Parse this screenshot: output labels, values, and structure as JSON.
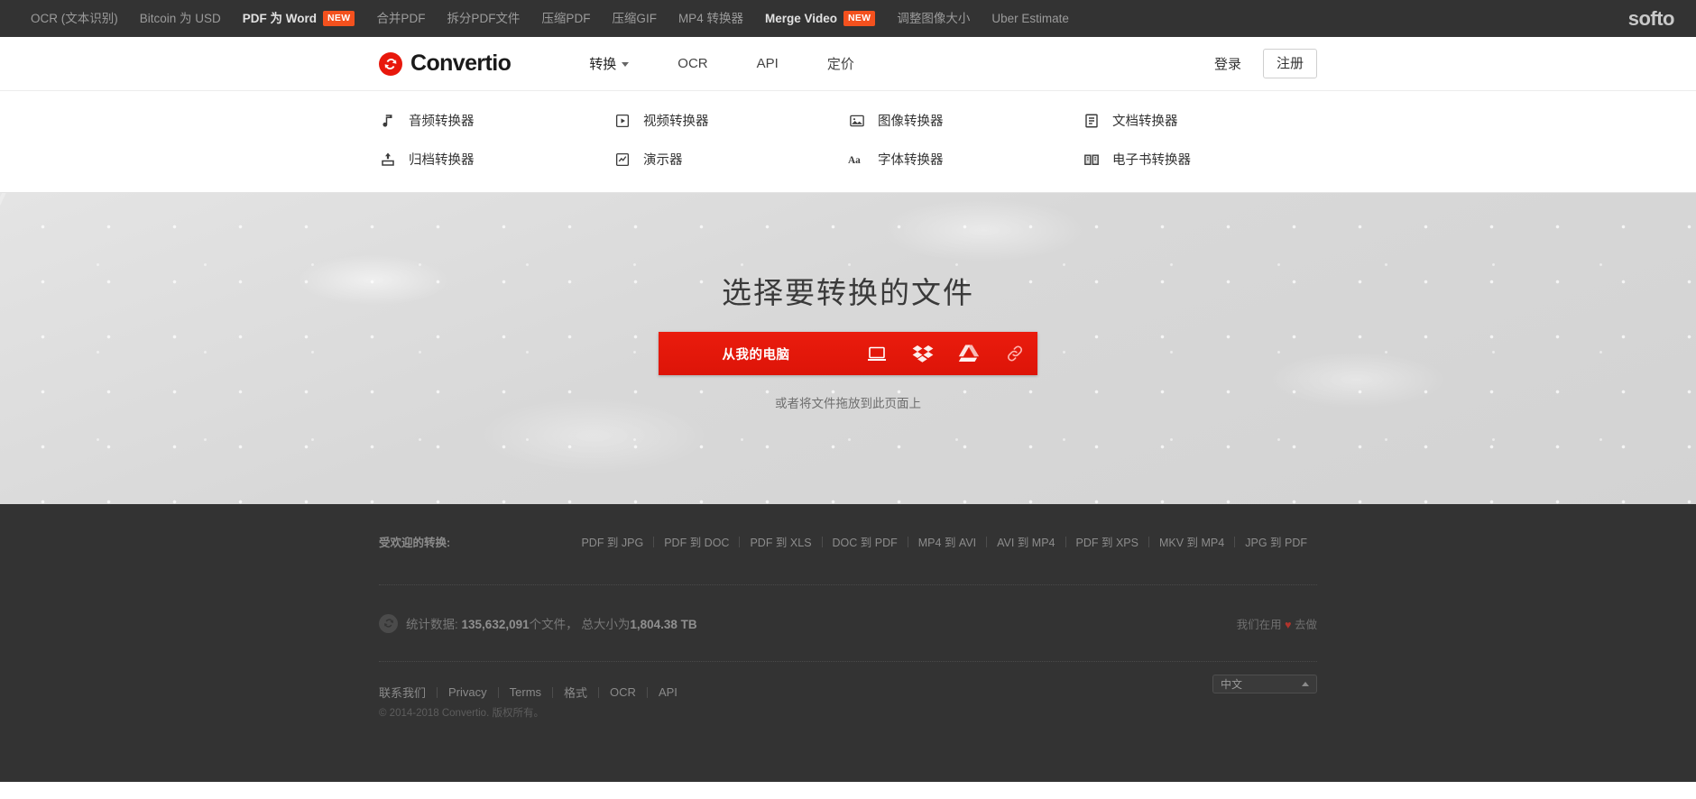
{
  "topbar": {
    "links": [
      {
        "label": "OCR (文本识别)",
        "bold": false,
        "badge": ""
      },
      {
        "label": "Bitcoin 为 USD",
        "bold": false,
        "badge": ""
      },
      {
        "label": "PDF 为 Word",
        "bold": true,
        "badge": "NEW"
      },
      {
        "label": "合并PDF",
        "bold": false,
        "badge": ""
      },
      {
        "label": "拆分PDF文件",
        "bold": false,
        "badge": ""
      },
      {
        "label": "压缩PDF",
        "bold": false,
        "badge": ""
      },
      {
        "label": "压缩GIF",
        "bold": false,
        "badge": ""
      },
      {
        "label": "MP4 转换器",
        "bold": false,
        "badge": ""
      },
      {
        "label": "Merge Video",
        "bold": true,
        "badge": "NEW"
      },
      {
        "label": "调整图像大小",
        "bold": false,
        "badge": ""
      },
      {
        "label": "Uber Estimate",
        "bold": false,
        "badge": ""
      }
    ],
    "brand": "softo",
    "badge_color": "#f4511e",
    "background": "#333333"
  },
  "header": {
    "logo_text": "Convertio",
    "logo_color": "#e8180c",
    "nav": [
      {
        "label": "转换",
        "has_caret": true
      },
      {
        "label": "OCR",
        "has_caret": false
      },
      {
        "label": "API",
        "has_caret": false
      },
      {
        "label": "定价",
        "has_caret": false
      }
    ],
    "login_label": "登录",
    "signup_label": "注册"
  },
  "megamenu": {
    "items": [
      {
        "label": "音频转换器",
        "icon": "music-note-icon"
      },
      {
        "label": "视频转换器",
        "icon": "video-play-icon"
      },
      {
        "label": "图像转换器",
        "icon": "image-icon"
      },
      {
        "label": "文档转换器",
        "icon": "document-icon"
      },
      {
        "label": "归档转换器",
        "icon": "archive-box-icon"
      },
      {
        "label": "演示器",
        "icon": "presentation-icon"
      },
      {
        "label": "字体转换器",
        "icon": "font-aa-icon"
      },
      {
        "label": "电子书转换器",
        "icon": "ebook-icon"
      }
    ]
  },
  "hero": {
    "title": "选择要转换的文件",
    "upload_label": "从我的电脑",
    "button_color": "#e8180c",
    "sources": [
      {
        "name": "my-computer",
        "icon": "laptop-icon"
      },
      {
        "name": "dropbox",
        "icon": "dropbox-icon"
      },
      {
        "name": "google-drive",
        "icon": "google-drive-icon"
      },
      {
        "name": "from-url",
        "icon": "link-icon"
      }
    ],
    "drop_hint": "或者将文件拖放到此页面上"
  },
  "footer": {
    "popular_label": "受欢迎的转换:",
    "popular_links": [
      "PDF 到 JPG",
      "PDF 到 DOC",
      "PDF 到 XLS",
      "DOC 到 PDF",
      "MP4 到 AVI",
      "AVI 到 MP4",
      "PDF 到 XPS",
      "MKV 到 MP4",
      "JPG 到 PDF"
    ],
    "stats_prefix": "统计数据:",
    "stats_files": "135,632,091",
    "stats_files_suffix": "个文件，",
    "stats_size_prefix": "总大小为",
    "stats_size": "1,804.38 TB",
    "made_with_prefix": "我们在用",
    "made_with_suffix": "去做",
    "heart": "♥",
    "bottom_links": [
      "联系我们",
      "Privacy",
      "Terms",
      "格式",
      "OCR",
      "API"
    ],
    "copyright": "© 2014-2018 Convertio. 版权所有。",
    "language": "中文"
  }
}
